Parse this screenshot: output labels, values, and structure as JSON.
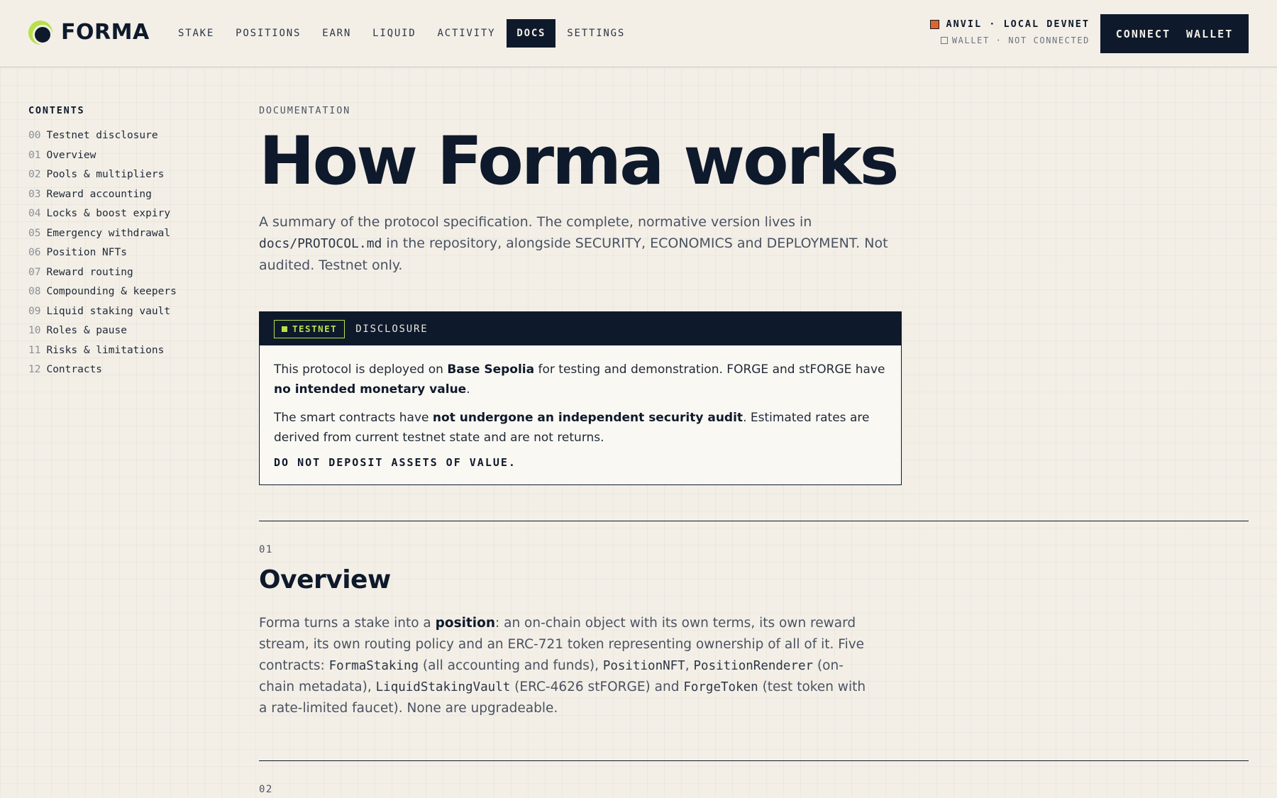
{
  "header": {
    "logo_text": "FORMA",
    "nav": [
      {
        "label": "STAKE",
        "active": false
      },
      {
        "label": "POSITIONS",
        "active": false
      },
      {
        "label": "EARN",
        "active": false
      },
      {
        "label": "LIQUID",
        "active": false
      },
      {
        "label": "ACTIVITY",
        "active": false
      },
      {
        "label": "DOCS",
        "active": true
      },
      {
        "label": "SETTINGS",
        "active": false
      }
    ],
    "network": "ANVIL · LOCAL DEVNET",
    "wallet_status": "WALLET · NOT CONNECTED",
    "connect_label": "CONNECT  WALLET"
  },
  "toc": {
    "title": "CONTENTS",
    "items": [
      {
        "num": "00",
        "label": "Testnet disclosure"
      },
      {
        "num": "01",
        "label": "Overview"
      },
      {
        "num": "02",
        "label": "Pools & multipliers"
      },
      {
        "num": "03",
        "label": "Reward accounting"
      },
      {
        "num": "04",
        "label": "Locks & boost expiry"
      },
      {
        "num": "05",
        "label": "Emergency withdrawal"
      },
      {
        "num": "06",
        "label": "Position NFTs"
      },
      {
        "num": "07",
        "label": "Reward routing"
      },
      {
        "num": "08",
        "label": "Compounding & keepers"
      },
      {
        "num": "09",
        "label": "Liquid staking vault"
      },
      {
        "num": "10",
        "label": "Roles & pause"
      },
      {
        "num": "11",
        "label": "Risks & limitations"
      },
      {
        "num": "12",
        "label": "Contracts"
      }
    ]
  },
  "main": {
    "eyebrow": "DOCUMENTATION",
    "title": "How Forma works",
    "lead": {
      "part1": "A summary of the protocol specification. The complete, normative version lives in",
      "code": "docs/PROTOCOL.md",
      "part2": " in the repository, alongside SECURITY, ECONOMICS and DEPLOYMENT. Not audited. Testnet only."
    },
    "disclosure": {
      "badge": "TESTNET",
      "label": "DISCLOSURE",
      "p1": {
        "a": "This protocol is deployed on ",
        "b1": "Base Sepolia",
        "c": " for testing and demonstration. FORGE and stFORGE have ",
        "b2": "no intended monetary value",
        "d": "."
      },
      "p2": {
        "a": "The smart contracts have ",
        "b1": "not undergone an independent security audit",
        "c": ". Estimated rates are derived from current testnet state and are not returns."
      },
      "warning": "DO NOT DEPOSIT ASSETS OF VALUE."
    },
    "overview": {
      "num": "01",
      "title": "Overview",
      "t1": "Forma turns a stake into a ",
      "b1": "position",
      "t2": ": an on-chain object with its own terms, its own reward stream, its own routing policy and an ERC-721 token representing ownership of all of it. Five contracts: ",
      "c1": "FormaStaking",
      "t3": " (all accounting and funds), ",
      "c2": "PositionNFT",
      "t4": ", ",
      "c3": "PositionRenderer",
      "t5": " (on-chain metadata), ",
      "c4": "LiquidStakingVault",
      "t6": " (ERC-4626 stFORGE) and ",
      "c5": "ForgeToken",
      "t7": " (test token with a rate-limited faucet). None are upgradeable."
    },
    "next_section_num": "02"
  }
}
